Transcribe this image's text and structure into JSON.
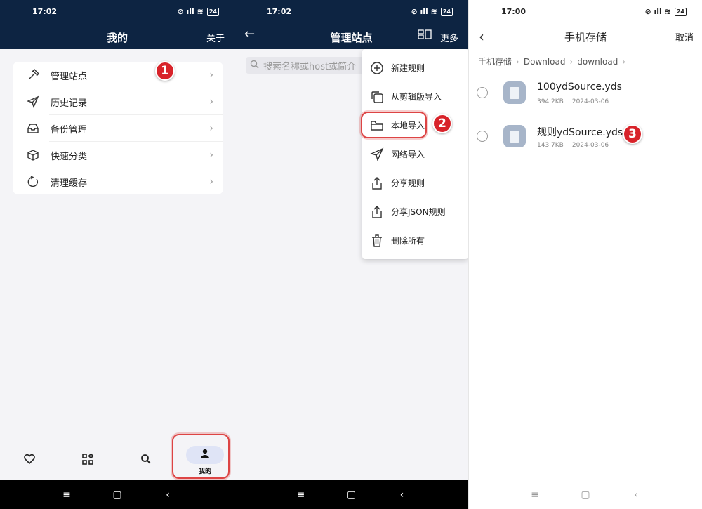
{
  "panel1": {
    "status_time": "17:02",
    "battery": "24",
    "title": "我的",
    "about": "关于",
    "menu": [
      {
        "label": "管理站点",
        "icon": "hammer-icon"
      },
      {
        "label": "历史记录",
        "icon": "send-icon"
      },
      {
        "label": "备份管理",
        "icon": "inbox-icon"
      },
      {
        "label": "快速分类",
        "icon": "cube-icon"
      },
      {
        "label": "清理缓存",
        "icon": "refresh-icon"
      }
    ],
    "badge": "1",
    "nav": {
      "mine_label": "我的"
    }
  },
  "panel2": {
    "status_time": "17:02",
    "battery": "24",
    "title": "管理站点",
    "more": "更多",
    "search_placeholder": "搜索名称或host或简介",
    "dropdown": [
      {
        "label": "新建规则",
        "icon": "plus-circle-icon"
      },
      {
        "label": "从剪辑版导入",
        "icon": "copy-icon"
      },
      {
        "label": "本地导入",
        "icon": "folder-icon"
      },
      {
        "label": "网络导入",
        "icon": "send-icon"
      },
      {
        "label": "分享规则",
        "icon": "share-icon"
      },
      {
        "label": "分享JSON规则",
        "icon": "share-icon"
      },
      {
        "label": "删除所有",
        "icon": "trash-icon"
      }
    ],
    "badge": "2"
  },
  "panel3": {
    "status_time": "17:00",
    "battery": "24",
    "title": "手机存储",
    "cancel": "取消",
    "breadcrumb": [
      "手机存储",
      "Download",
      "download"
    ],
    "files": [
      {
        "name": "100ydSource.yds",
        "size": "394.2KB",
        "date": "2024-03-06"
      },
      {
        "name": "规则ydSource.yds",
        "size": "143.7KB",
        "date": "2024-03-06"
      }
    ],
    "badge": "3"
  },
  "colors": {
    "appbar": "#0d2442",
    "badge": "#d8232a",
    "nav_pill": "#dfe4f6"
  }
}
